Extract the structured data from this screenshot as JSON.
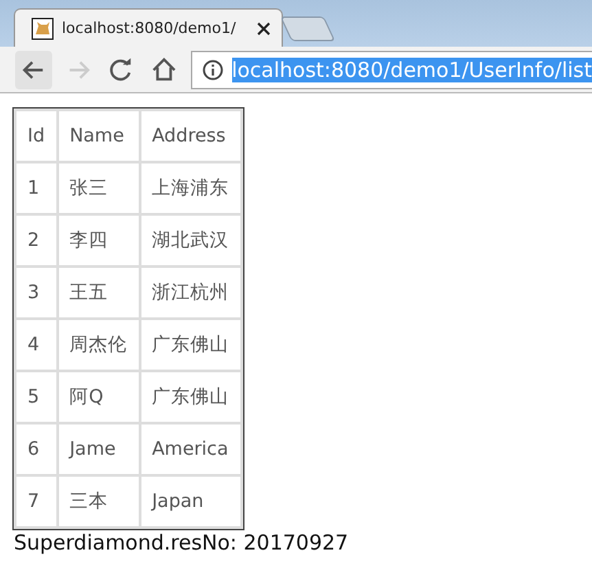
{
  "browser": {
    "tab": {
      "title": "localhost:8080/demo1/"
    },
    "address": "localhost:8080/demo1/UserInfo/list"
  },
  "table": {
    "columns": [
      "Id",
      "Name",
      "Address"
    ],
    "rows": [
      [
        "1",
        "张三",
        "上海浦东"
      ],
      [
        "2",
        "李四",
        "湖北武汉"
      ],
      [
        "3",
        "王五",
        "浙江杭州"
      ],
      [
        "4",
        "周杰伦",
        "广东佛山"
      ],
      [
        "5",
        "阿Q",
        "广东佛山"
      ],
      [
        "6",
        "Jame",
        "America"
      ],
      [
        "7",
        "三本",
        "Japan"
      ]
    ]
  },
  "footer": "Superdiamond.resNo: 20170927"
}
